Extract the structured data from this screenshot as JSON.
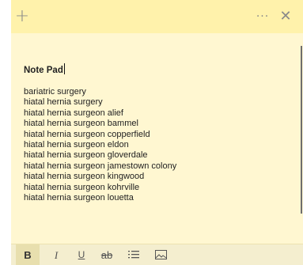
{
  "titlebar": {
    "add_icon": "plus-icon",
    "more_label": "···",
    "close_label": "✕"
  },
  "note": {
    "title": "Note Pad",
    "lines": [
      "bariatric surgery",
      "hiatal hernia surgery",
      "hiatal hernia surgeon alief",
      "hiatal hernia surgeon bammel",
      "hiatal hernia surgeon copperfield",
      "hiatal hernia surgeon eldon",
      "hiatal hernia surgeon gloverdale",
      "hiatal hernia surgeon jamestown colony",
      "hiatal hernia surgeon kingwood",
      "hiatal hernia surgeon kohrville",
      "hiatal hernia surgeon louetta"
    ]
  },
  "toolbar": {
    "bold_label": "B",
    "italic_label": "I",
    "underline_label": "U",
    "strike_label": "ab"
  },
  "colors": {
    "note_background": "#fff7d1",
    "titlebar_background": "#fff2ab"
  }
}
